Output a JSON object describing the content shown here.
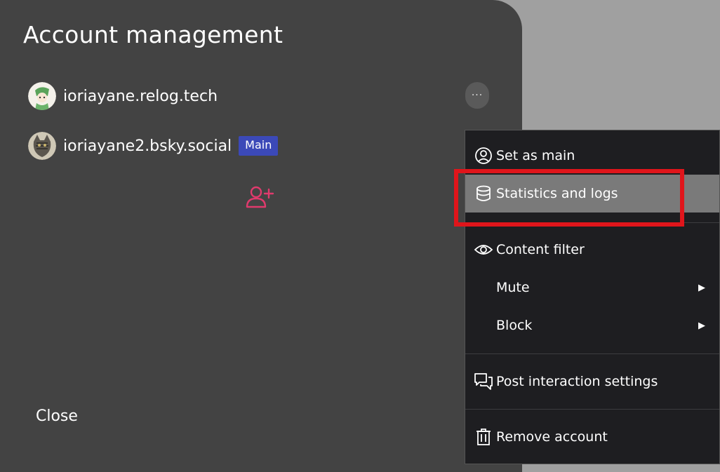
{
  "dialog": {
    "title": "Account management",
    "accounts": [
      {
        "handle": "ioriayane.relog.tech",
        "badge": null
      },
      {
        "handle": "ioriayane2.bsky.social",
        "badge": "Main"
      }
    ],
    "more_label": "···",
    "close_label": "Close"
  },
  "menu": {
    "items": [
      {
        "label": "Set as main",
        "icon": "user-circle-icon"
      },
      {
        "label": "Statistics and logs",
        "icon": "database-icon"
      },
      {
        "label": "Content filter",
        "icon": "eye-icon"
      },
      {
        "label": "Mute",
        "icon": null,
        "submenu": true
      },
      {
        "label": "Block",
        "icon": null,
        "submenu": true
      },
      {
        "label": "Post interaction settings",
        "icon": "chat-bubbles-icon"
      },
      {
        "label": "Remove account",
        "icon": "trash-icon"
      }
    ],
    "submenu_arrow": "▶"
  },
  "colors": {
    "dialog_bg": "#434343",
    "menu_bg": "#1e1e21",
    "badge_bg": "#3b49b8",
    "add_account_accent": "#e03a6d",
    "highlight_bg": "#7a7a7a",
    "annotation": "#e0151b"
  }
}
